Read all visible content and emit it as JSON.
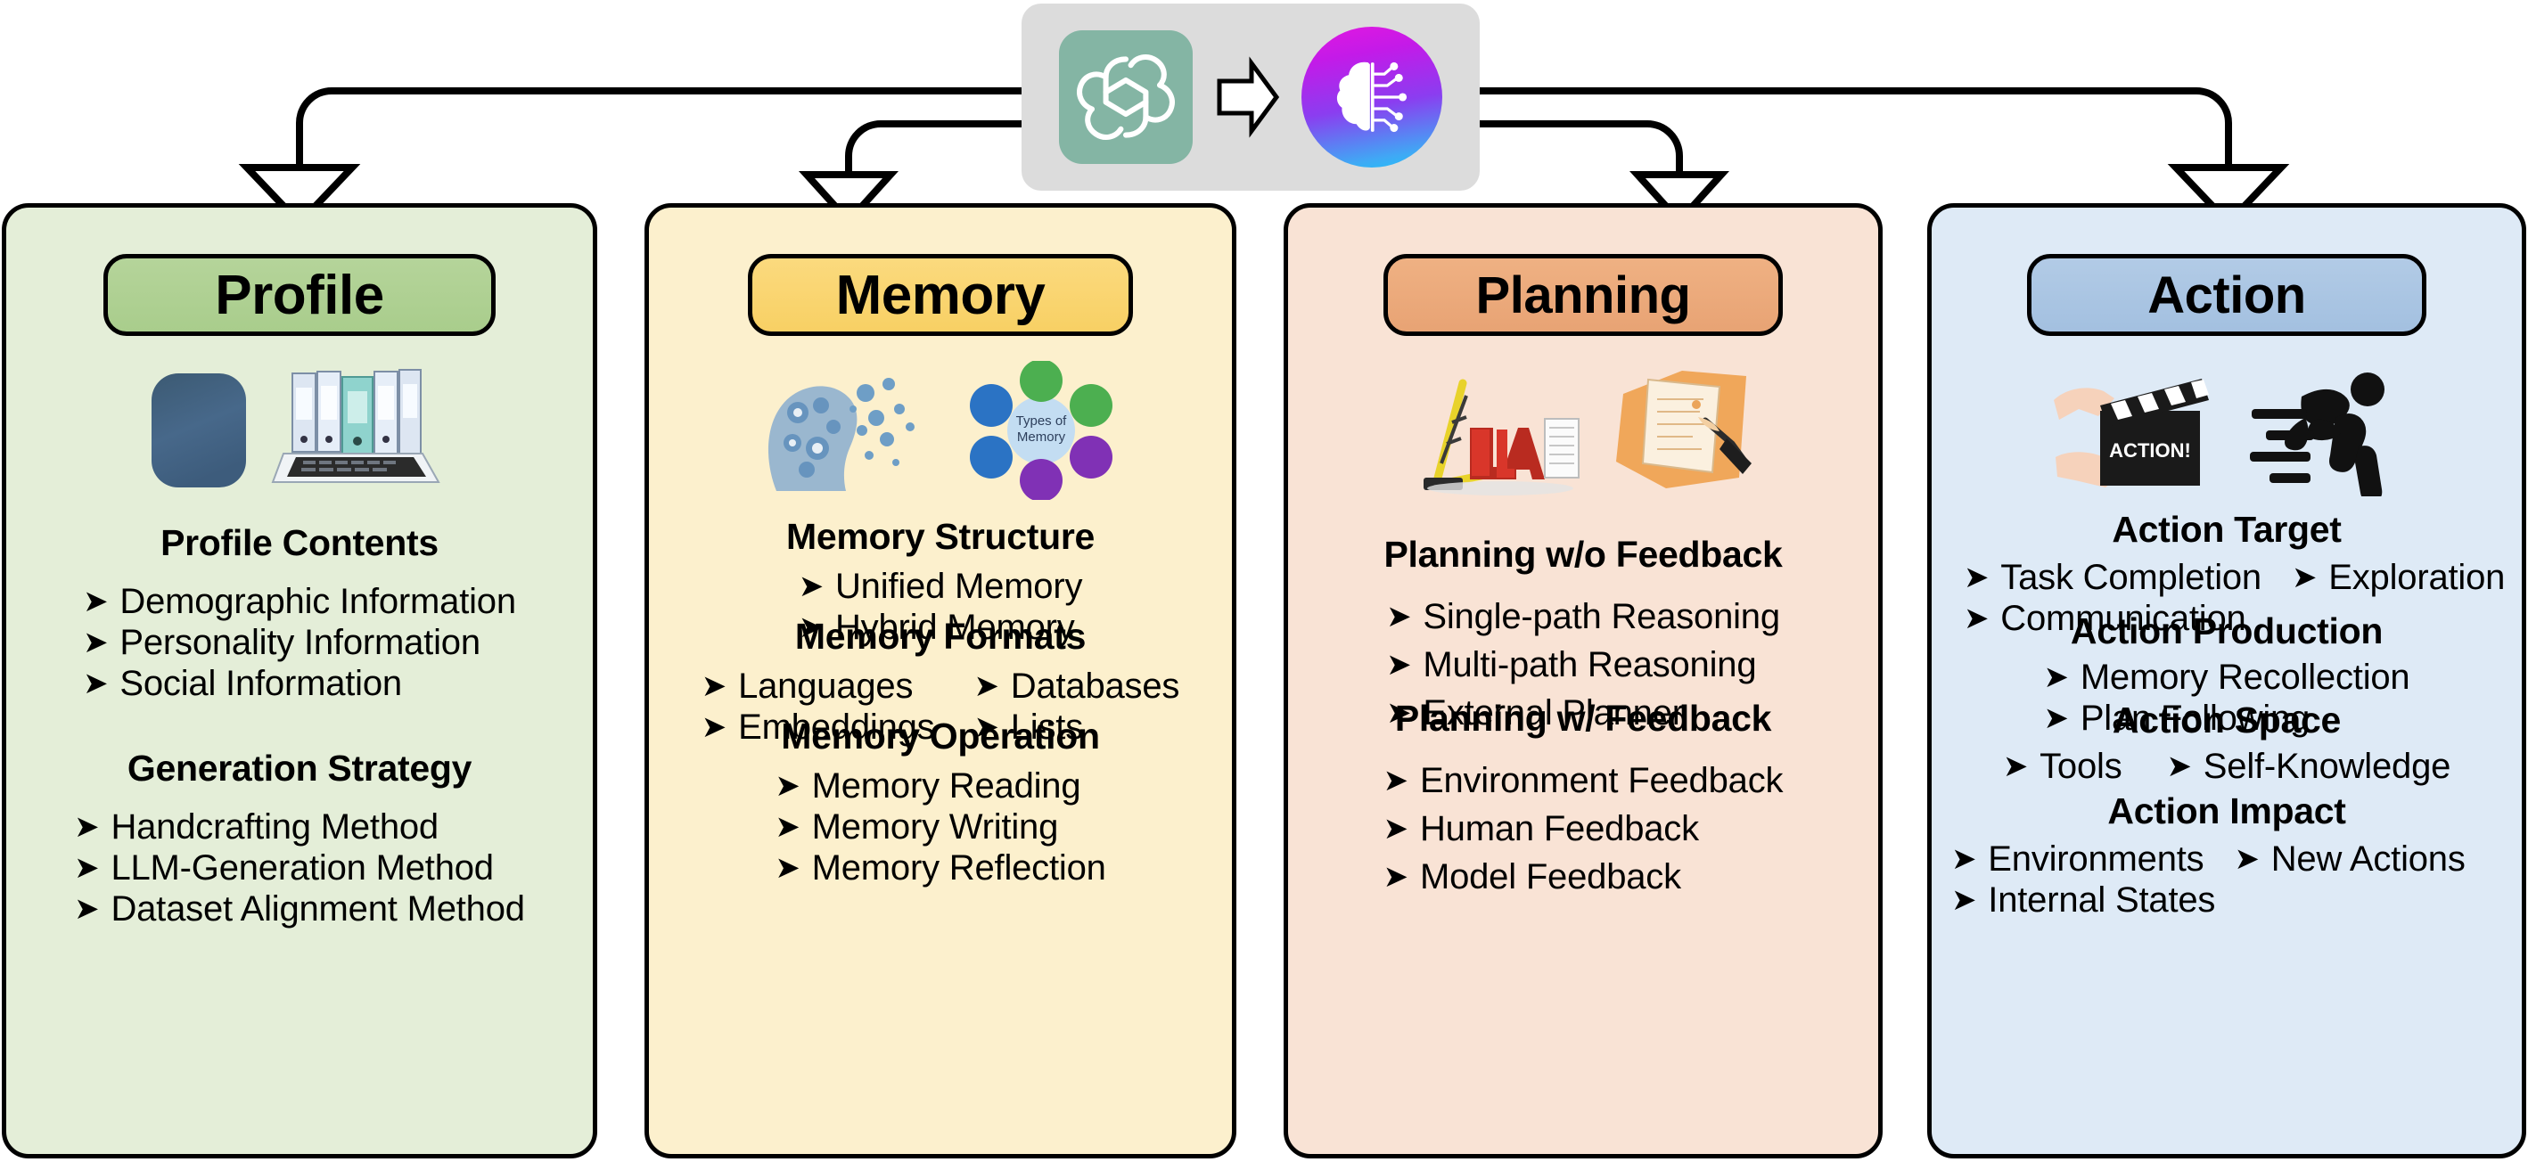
{
  "header": {
    "source_logo": "openai-logo",
    "transition_icon": "right-arrow-icon",
    "target_logo": "ai-brain-logo"
  },
  "panels": [
    {
      "id": "profile",
      "title": "Profile",
      "accent": "#a9cd8c",
      "background": "#e4eed8",
      "icons": [
        "person-silhouette-icon",
        "binders-laptop-icon"
      ],
      "sections": [
        {
          "heading": "Profile Contents",
          "layout": "single",
          "items": [
            "Demographic Information",
            "Personality Information",
            "Social Information"
          ]
        },
        {
          "heading": "Generation Strategy",
          "layout": "single",
          "items": [
            "Handcrafting Method",
            "LLM-Generation Method",
            "Dataset  Alignment Method"
          ]
        }
      ]
    },
    {
      "id": "memory",
      "title": "Memory",
      "accent": "#f8d064",
      "background": "#fcf0cd",
      "icons": [
        "head-particles-icon",
        "types-of-memory-diagram-icon"
      ],
      "sections": [
        {
          "heading": "Memory Structure",
          "layout": "single",
          "items": [
            "Unified Memory",
            "Hybrid Memory"
          ]
        },
        {
          "heading": "Memory Formats",
          "layout": "two-column",
          "columns": [
            [
              "Languages",
              "Embeddings"
            ],
            [
              "Databases",
              "Lists"
            ]
          ]
        },
        {
          "heading": "Memory Operation",
          "layout": "single",
          "items": [
            "Memory Reading",
            "Memory Writing",
            "Memory Reflection"
          ]
        }
      ]
    },
    {
      "id": "planning",
      "title": "Planning",
      "accent": "#e8a374",
      "background": "#f9e3d5",
      "icons": [
        "plan-crane-blocks-icon",
        "hand-writing-document-icon"
      ],
      "sections": [
        {
          "heading": "Planning w/o Feedback",
          "layout": "single",
          "items": [
            "Single-path Reasoning",
            "Multi-path Reasoning",
            "External Planner"
          ]
        },
        {
          "heading": "Planning w/ Feedback",
          "layout": "single",
          "items": [
            "Environment Feedback",
            "Human Feedback",
            "Model Feedback"
          ]
        }
      ]
    },
    {
      "id": "action",
      "title": "Action",
      "accent": "#a3c0e0",
      "background": "#deeaf6",
      "icons": [
        "clapperboard-hands-icon",
        "running-person-icon"
      ],
      "sections": [
        {
          "heading": "Action Target",
          "layout": "two-column-wrap",
          "row1": [
            "Task Completion",
            "Exploration"
          ],
          "row2": [
            "Communication"
          ]
        },
        {
          "heading": "Action Production",
          "layout": "single",
          "items": [
            "Memory Recollection",
            "Plan Following"
          ]
        },
        {
          "heading": "Action Space",
          "layout": "two-column-wrap",
          "row1": [
            "Tools",
            "Self-Knowledge"
          ],
          "row2": []
        },
        {
          "heading": "Action Impact",
          "layout": "two-column-wrap",
          "row1": [
            "Environments",
            "New Actions"
          ],
          "row2": [
            "Internal States"
          ]
        }
      ]
    }
  ],
  "bullet_glyph": "➤"
}
